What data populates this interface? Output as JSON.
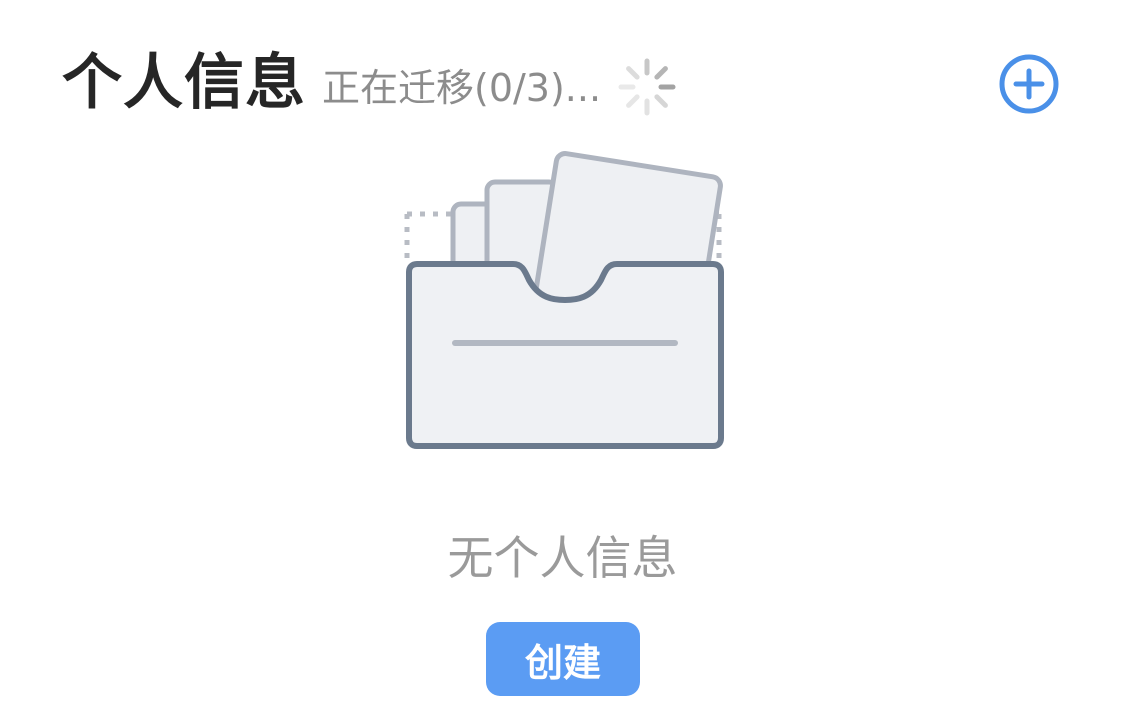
{
  "header": {
    "title": "个人信息",
    "migration_status": "正在迁移(0/3)..."
  },
  "icons": {
    "loading": "loading-spinner-icon",
    "add": "plus-circle-icon",
    "empty": "empty-folder-illustration"
  },
  "empty_state": {
    "message": "无个人信息",
    "create_label": "创建"
  },
  "colors": {
    "accent": "#5b9cf3",
    "title": "#262626",
    "muted": "#9a9a9a"
  }
}
